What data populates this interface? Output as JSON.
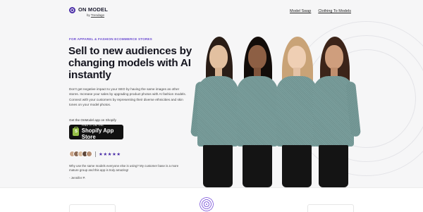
{
  "brand": {
    "name": "ON MODEL",
    "by_prefix": "by ",
    "by_name": "Trendage",
    "accent_color": "#4b2ea8"
  },
  "nav": {
    "items": [
      {
        "label": "Model Swap"
      },
      {
        "label": "Clothing To Models"
      }
    ]
  },
  "hero": {
    "eyebrow": "FOR APPAREL & FASHION ECOMMERCE STORES",
    "headline": "Sell to new audiences by changing models with AI instantly",
    "description": "Don't get negative impact to your SEO by having the same images as other stores. Increase your sales by upgrading product photos with AI fashion models. Connect with your customers by representing their diverse ethnicities and skin tones on your model photos.",
    "app_caption": "Get the OnModel app on Shopify",
    "badge_small": "FIND IT ON THE",
    "badge_big": "Shopify App Store",
    "stars": "★★★★★",
    "review": "Why use the same models everyone else is using? My customer base is a more mature group and this app is truly amazing!",
    "review_author": "- Jennifer P."
  },
  "icons": {
    "logo": "onmodel-logo-icon",
    "shopify": "shopify-bag-icon",
    "decorative": "swirl-ring-icon"
  }
}
